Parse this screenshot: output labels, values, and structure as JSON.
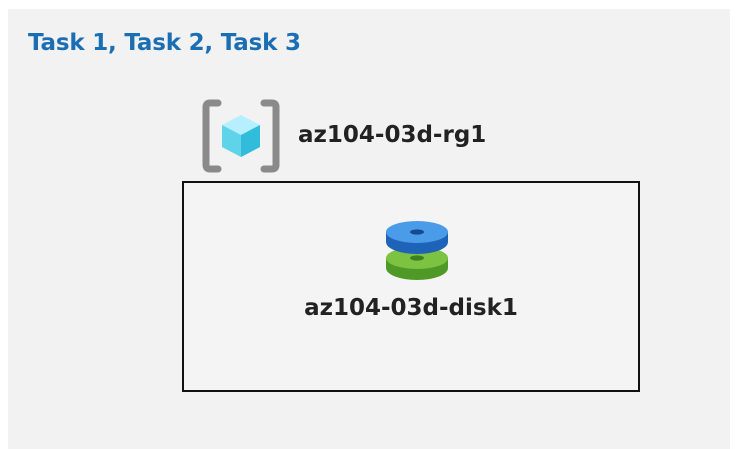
{
  "title": "Task 1, Task 2, Task 3",
  "resource_group": {
    "label": "az104-03d-rg1",
    "icon": "resource-group-icon"
  },
  "disk": {
    "label": "az104-03d-disk1",
    "icon": "managed-disk-icon"
  },
  "colors": {
    "title": "#1a6fb4",
    "panel_background": "#f2f2f2",
    "disk_top": "#3b8de0",
    "disk_bottom": "#6ab83a",
    "cube": "#5fd3ea",
    "bracket": "#8a8a8a"
  }
}
